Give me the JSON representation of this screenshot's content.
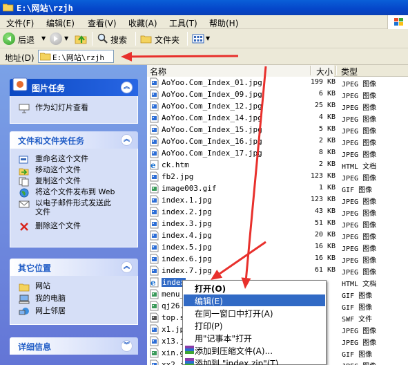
{
  "window": {
    "title": "E:\\网站\\rzjh"
  },
  "menu": {
    "items": [
      "文件(F)",
      "编辑(E)",
      "查看(V)",
      "收藏(A)",
      "工具(T)",
      "帮助(H)"
    ]
  },
  "toolbar": {
    "back_label": "后退",
    "search_label": "搜索",
    "folders_label": "文件夹"
  },
  "address": {
    "label": "地址(D)",
    "value": "E:\\网站\\rzjh"
  },
  "task_panels": {
    "picture": {
      "title": "图片任务",
      "items": [
        "作为幻灯片查看"
      ]
    },
    "file": {
      "title": "文件和文件夹任务",
      "items": [
        "重命名这个文件",
        "移动这个文件",
        "复制这个文件",
        "将这个文件发布到 Web",
        "以电子邮件形式发送此",
        "文件",
        "删除这个文件"
      ]
    },
    "places": {
      "title": "其它位置",
      "items": [
        "网站",
        "我的电脑",
        "网上邻居"
      ]
    },
    "details": {
      "title": "详细信息"
    }
  },
  "columns": {
    "name": "名称",
    "size": "大小",
    "type": "类型"
  },
  "files": [
    {
      "name": "AoYoo.Com_Index_01.jpg",
      "size": "199 KB",
      "type": "JPEG 图像",
      "icon": "jpeg-icon"
    },
    {
      "name": "AoYoo.Com_Index_09.jpg",
      "size": "6 KB",
      "type": "JPEG 图像",
      "icon": "jpeg-icon"
    },
    {
      "name": "AoYoo.Com_Index_12.jpg",
      "size": "25 KB",
      "type": "JPEG 图像",
      "icon": "jpeg-icon"
    },
    {
      "name": "AoYoo.Com_Index_14.jpg",
      "size": "4 KB",
      "type": "JPEG 图像",
      "icon": "jpeg-icon"
    },
    {
      "name": "AoYoo.Com_Index_15.jpg",
      "size": "5 KB",
      "type": "JPEG 图像",
      "icon": "jpeg-icon"
    },
    {
      "name": "AoYoo.Com_Index_16.jpg",
      "size": "2 KB",
      "type": "JPEG 图像",
      "icon": "jpeg-icon"
    },
    {
      "name": "AoYoo.Com_Index_17.jpg",
      "size": "8 KB",
      "type": "JPEG 图像",
      "icon": "jpeg-icon"
    },
    {
      "name": "ck.htm",
      "size": "2 KB",
      "type": "HTML 文档",
      "icon": "html-icon"
    },
    {
      "name": "fb2.jpg",
      "size": "123 KB",
      "type": "JPEG 图像",
      "icon": "jpeg-icon"
    },
    {
      "name": "image003.gif",
      "size": "1 KB",
      "type": "GIF 图像",
      "icon": "gif-icon"
    },
    {
      "name": "index.1.jpg",
      "size": "123 KB",
      "type": "JPEG 图像",
      "icon": "jpeg-icon"
    },
    {
      "name": "index.2.jpg",
      "size": "43 KB",
      "type": "JPEG 图像",
      "icon": "jpeg-icon"
    },
    {
      "name": "index.3.jpg",
      "size": "51 KB",
      "type": "JPEG 图像",
      "icon": "jpeg-icon"
    },
    {
      "name": "index.4.jpg",
      "size": "20 KB",
      "type": "JPEG 图像",
      "icon": "jpeg-icon"
    },
    {
      "name": "index.5.jpg",
      "size": "16 KB",
      "type": "JPEG 图像",
      "icon": "jpeg-icon"
    },
    {
      "name": "index.6.jpg",
      "size": "16 KB",
      "type": "JPEG 图像",
      "icon": "jpeg-icon"
    },
    {
      "name": "index.7.jpg",
      "size": "61 KB",
      "type": "JPEG 图像",
      "icon": "jpeg-icon"
    },
    {
      "name": "index",
      "size": "",
      "type": "HTML 文档",
      "icon": "html-icon"
    },
    {
      "name": "menu_",
      "size": "",
      "type": "GIF 图像",
      "icon": "gif-icon"
    },
    {
      "name": "qj26.",
      "size": "",
      "type": "GIF 图像",
      "icon": "gif-icon"
    },
    {
      "name": "top.s",
      "size": "",
      "type": "SWF 文件",
      "icon": "swf-icon"
    },
    {
      "name": "x1.jp",
      "size": "",
      "type": "JPEG 图像",
      "icon": "jpeg-icon"
    },
    {
      "name": "x13.j",
      "size": "",
      "type": "JPEG 图像",
      "icon": "jpeg-icon"
    },
    {
      "name": "xin.g",
      "size": "",
      "type": "GIF 图像",
      "icon": "gif-icon"
    },
    {
      "name": "xx2.j",
      "size": "",
      "type": "JPEG 图像",
      "icon": "jpeg-icon"
    }
  ],
  "context_menu": {
    "items": [
      "打开(O)",
      "编辑(E)",
      "在同一窗口中打开(A)",
      "打印(P)",
      "用\"记事本\"打开",
      "添加到压缩文件(A)...",
      "添加到 \"index.zip\"(T)"
    ]
  },
  "colors": {
    "annotation_arrow": "#e8302c",
    "selection": "#316ac5",
    "task_pane": "#6375d6"
  }
}
